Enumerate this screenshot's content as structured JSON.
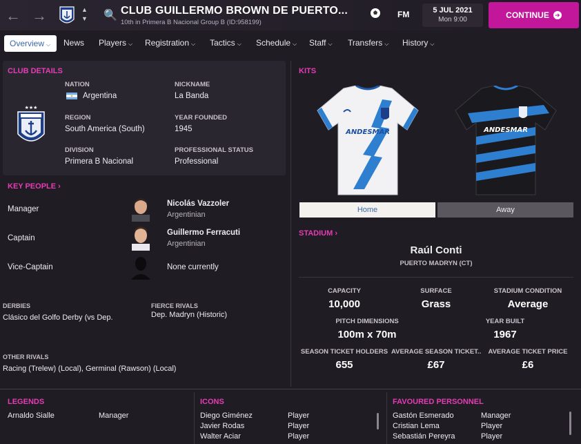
{
  "header": {
    "title": "CLUB GUILLERMO BROWN DE PUERTO...",
    "subtitle": "10th in Primera B Nacional Group B (ID:958199)",
    "fm_label": "FM",
    "date": "5 JUL 2021",
    "time": "Mon 9:00",
    "continue_label": "CONTINUE",
    "accent": "#c2179a"
  },
  "tabs": [
    {
      "label": "Overview",
      "active": true
    },
    {
      "label": "News"
    },
    {
      "label": "Players"
    },
    {
      "label": "Registration"
    },
    {
      "label": "Tactics"
    },
    {
      "label": "Schedule"
    },
    {
      "label": "Staff"
    },
    {
      "label": "Transfers"
    },
    {
      "label": "History"
    }
  ],
  "club_details": {
    "heading": "CLUB DETAILS",
    "nation_label": "NATION",
    "nation": "Argentina",
    "nickname_label": "NICKNAME",
    "nickname": "La Banda",
    "region_label": "REGION",
    "region": "South America (South)",
    "founded_label": "YEAR FOUNDED",
    "founded": "1945",
    "division_label": "DIVISION",
    "division": "Primera B Nacional",
    "status_label": "PROFESSIONAL STATUS",
    "status": "Professional"
  },
  "key_people": {
    "heading": "KEY PEOPLE",
    "rows": [
      {
        "role": "Manager",
        "name": "Nicolás Vazzoler",
        "nat": "Argentinian"
      },
      {
        "role": "Captain",
        "name": "Guillermo Ferracuti",
        "nat": "Argentinian"
      },
      {
        "role": "Vice-Captain",
        "name": "None currently",
        "nat": ""
      }
    ]
  },
  "rivals": {
    "derbies_label": "DERBIES",
    "derbies": "Clásico del Golfo Derby (vs Dep.",
    "fierce_label": "FIERCE RIVALS",
    "fierce": "Dep. Madryn (Historic)",
    "other_label": "OTHER RIVALS",
    "other": "Racing (Trelew) (Local), Germinal (Rawson) (Local)"
  },
  "kits": {
    "heading": "KITS",
    "sponsor": "ANDESMAR",
    "home_label": "Home",
    "away_label": "Away"
  },
  "stadium": {
    "heading": "STADIUM",
    "name": "Raúl Conti",
    "location": "PUERTO MADRYN (CT)",
    "capacity_label": "CAPACITY",
    "capacity": "10,000",
    "surface_label": "SURFACE",
    "surface": "Grass",
    "condition_label": "STADIUM CONDITION",
    "condition": "Average",
    "pitch_label": "PITCH DIMENSIONS",
    "pitch": "100m x 70m",
    "built_label": "YEAR BUILT",
    "built": "1967",
    "stholders_label": "SEASON TICKET HOLDERS",
    "stholders": "655",
    "avg_st_label": "AVERAGE SEASON TICKET...",
    "avg_st": "£67",
    "avg_ticket_label": "AVERAGE TICKET PRICE",
    "avg_ticket": "£6"
  },
  "legends": {
    "heading": "LEGENDS",
    "rows": [
      {
        "name": "Arnaldo Sialle",
        "role": "Manager"
      }
    ]
  },
  "icons": {
    "heading": "ICONS",
    "rows": [
      {
        "name": "Diego Giménez",
        "role": "Player"
      },
      {
        "name": "Javier Rodas",
        "role": "Player"
      },
      {
        "name": "Walter Aciar",
        "role": "Player"
      }
    ]
  },
  "favoured": {
    "heading": "FAVOURED PERSONNEL",
    "rows": [
      {
        "name": "Gastón Esmerado",
        "role": "Manager"
      },
      {
        "name": "Cristian Lema",
        "role": "Player"
      },
      {
        "name": "Sebastián Pereyra",
        "role": "Player"
      }
    ]
  }
}
